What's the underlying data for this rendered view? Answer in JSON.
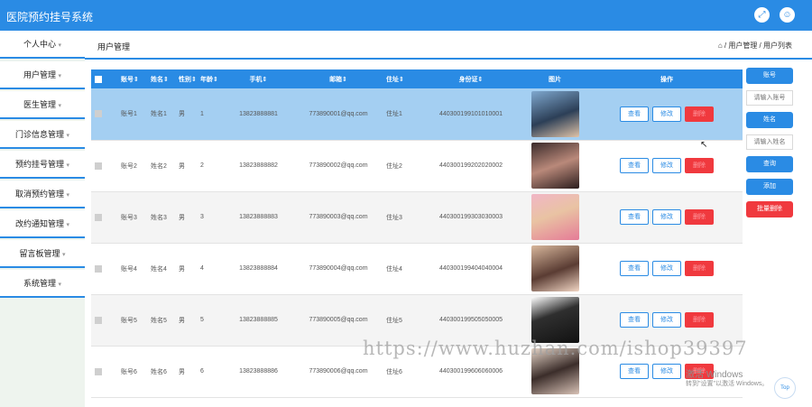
{
  "app": {
    "title": "医院预约挂号系统"
  },
  "header": {
    "fullscreen_icon": "expand-icon",
    "user_icon": "user-icon"
  },
  "sidebar": {
    "items": [
      {
        "label": "个人中心"
      },
      {
        "label": "用户管理"
      },
      {
        "label": "医生管理"
      },
      {
        "label": "门诊信息管理"
      },
      {
        "label": "预约挂号管理"
      },
      {
        "label": "取消预约管理"
      },
      {
        "label": "改约通知管理"
      },
      {
        "label": "留言板管理"
      },
      {
        "label": "系统管理"
      }
    ],
    "caret": "▾"
  },
  "page": {
    "title": "用户管理",
    "breadcrumb": "⌂ / 用户管理 / 用户列表"
  },
  "table": {
    "columns": [
      "账号⇕",
      "姓名⇕",
      "性别⇕",
      "年龄⇕",
      "手机⇕",
      "邮箱⇕",
      "住址⇕",
      "身份证⇕",
      "图片",
      "操作"
    ],
    "actions": {
      "view": "查看",
      "edit": "修改",
      "delete": "删除"
    },
    "rows": [
      {
        "account": "账号1",
        "name": "姓名1",
        "gender": "男",
        "age": "1",
        "phone": "13823888881",
        "email": "773890001@qq.com",
        "address": "住址1",
        "idcard": "440300199101010001"
      },
      {
        "account": "账号2",
        "name": "姓名2",
        "gender": "男",
        "age": "2",
        "phone": "13823888882",
        "email": "773890002@qq.com",
        "address": "住址2",
        "idcard": "440300199202020002"
      },
      {
        "account": "账号3",
        "name": "姓名3",
        "gender": "男",
        "age": "3",
        "phone": "13823888883",
        "email": "773890003@qq.com",
        "address": "住址3",
        "idcard": "440300199303030003"
      },
      {
        "account": "账号4",
        "name": "姓名4",
        "gender": "男",
        "age": "4",
        "phone": "13823888884",
        "email": "773890004@qq.com",
        "address": "住址4",
        "idcard": "440300199404040004"
      },
      {
        "account": "账号5",
        "name": "姓名5",
        "gender": "男",
        "age": "5",
        "phone": "13823888885",
        "email": "773890005@qq.com",
        "address": "住址5",
        "idcard": "440300199505050005"
      },
      {
        "account": "账号6",
        "name": "姓名6",
        "gender": "男",
        "age": "6",
        "phone": "13823888886",
        "email": "773890006@qq.com",
        "address": "住址6",
        "idcard": "440300199606060006"
      }
    ]
  },
  "search_panel": {
    "account_label": "账号",
    "account_placeholder": "请输入账号",
    "name_label": "姓名",
    "name_placeholder": "请输入姓名",
    "search": "查询",
    "add": "添加",
    "batch_delete": "批量删除"
  },
  "overlay": {
    "watermark": "https://www.huzhan.com/ishop39397",
    "activate_title": "激活 Windows",
    "activate_sub": "转到\"设置\"以激活 Windows。",
    "top_button": "Top"
  },
  "colors": {
    "primary": "#2a8be4",
    "danger": "#f0393e",
    "selected_row": "#a4cff2"
  }
}
